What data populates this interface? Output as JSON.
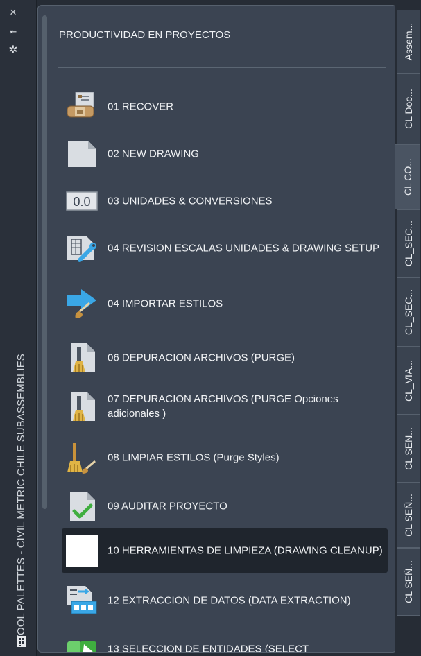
{
  "window": {
    "close_glyph": "×",
    "autohide_glyph": "⇤",
    "properties_glyph": "✲",
    "vertical_title": "TOOL PALETTES - CIVIL METRIC CHILE SUBASSEMBLIES"
  },
  "palette": {
    "title": "PRODUCTIVIDAD EN PROYECTOS",
    "tools": [
      {
        "label": "01 RECOVER",
        "icon": "recover-icon"
      },
      {
        "label": "02 NEW DRAWING",
        "icon": "new-drawing-icon"
      },
      {
        "label": "03 UNIDADES & CONVERSIONES",
        "icon": "units-icon",
        "icon_text": "0.0"
      },
      {
        "label": "04 REVISION ESCALAS UNIDADES  & DRAWING SETUP",
        "icon": "drawing-setup-icon"
      },
      {
        "label": "04 IMPORTAR ESTILOS",
        "icon": "import-styles-icon"
      },
      {
        "label": "06 DEPURACION ARCHIVOS (PURGE)",
        "icon": "purge-icon"
      },
      {
        "label": "07 DEPURACION ARCHIVOS (PURGE Opciones adicionales )",
        "icon": "purge-options-icon"
      },
      {
        "label": "08 LIMPIAR ESTILOS (Purge Styles)",
        "icon": "purge-styles-icon"
      },
      {
        "label": "09 AUDITAR PROYECTO",
        "icon": "audit-icon"
      },
      {
        "label": "10 HERRAMIENTAS DE LIMPIEZA (DRAWING CLEANUP)",
        "icon": "drawing-cleanup-icon"
      },
      {
        "label": "12 EXTRACCION DE DATOS (DATA EXTRACTION)",
        "icon": "data-extraction-icon"
      },
      {
        "label": "13 SELECCION DE ENTIDADES (SELECT",
        "icon": "select-entities-icon"
      }
    ]
  },
  "tabs": [
    {
      "label": "Assem..."
    },
    {
      "label": "CL Doc..."
    },
    {
      "label": "CL CO..."
    },
    {
      "label": "CL_SEC..."
    },
    {
      "label": "CL_SEC..."
    },
    {
      "label": "CL_VIA..."
    },
    {
      "label": "CL SEN..."
    },
    {
      "label": "CL SEÑ..."
    },
    {
      "label": "CL SEÑ..."
    }
  ],
  "colors": {
    "panel": "#3b4452",
    "selected_row": "#1f252d",
    "check_green": "#3fae3f",
    "arrow_blue": "#3aa7e6"
  }
}
